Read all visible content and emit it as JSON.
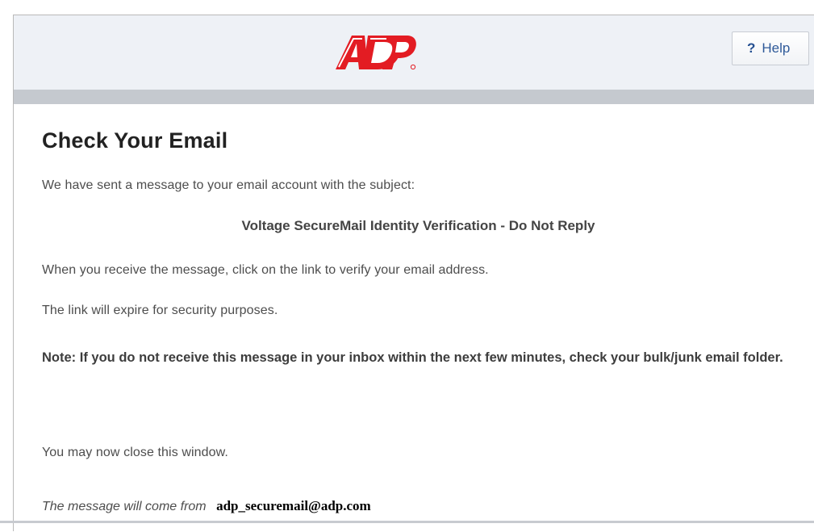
{
  "header": {
    "logo_text": "ADP",
    "help_icon": "question-mark-icon",
    "help_label": "Help"
  },
  "content": {
    "title": "Check Your Email",
    "line1": "We have sent a message to your email account with the subject:",
    "subject": "Voltage SecureMail Identity Verification - Do Not Reply",
    "line2": "When you receive the message, click on the link to verify your email address.",
    "line3": "The link will expire for security purposes.",
    "note": "Note: If you do not receive this message in your inbox within the next few minutes, check your bulk/junk email folder.",
    "close_text": "You may now close this window.",
    "from_label": "The message will come from",
    "from_email": "adp_securemail@adp.com"
  },
  "colors": {
    "brand_red": "#e31c23",
    "header_bg": "#eef1f6",
    "divider_bar": "#c5c9cf",
    "help_text": "#2f5a99"
  }
}
